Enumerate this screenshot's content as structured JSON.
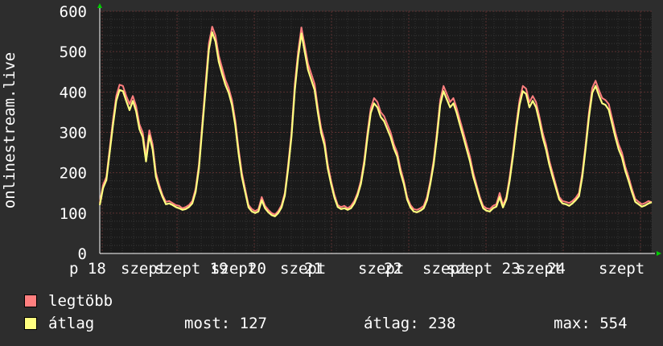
{
  "chart_data": {
    "type": "line",
    "ylabel": "onlinestream.live",
    "ylim": [
      0,
      600
    ],
    "y_ticks": [
      0,
      100,
      200,
      300,
      400,
      500,
      600
    ],
    "x_tick_labels": [
      "p 18",
      "szept",
      "szept 19",
      "szept",
      "20",
      "szept",
      "21",
      "szept",
      "22",
      "szept",
      "szept 23",
      "szept",
      "24",
      "szept"
    ],
    "grid": true,
    "series": [
      {
        "name": "legtöbb",
        "color": "#ff7f7f",
        "values": [
          125,
          170,
          190,
          260,
          330,
          390,
          418,
          415,
          390,
          370,
          390,
          365,
          320,
          300,
          240,
          305,
          270,
          200,
          170,
          145,
          128,
          130,
          125,
          120,
          118,
          112,
          115,
          120,
          130,
          160,
          220,
          320,
          420,
          520,
          562,
          540,
          490,
          460,
          430,
          410,
          380,
          330,
          260,
          200,
          160,
          120,
          110,
          105,
          110,
          140,
          118,
          108,
          100,
          96,
          105,
          120,
          150,
          220,
          300,
          420,
          500,
          560,
          515,
          470,
          445,
          420,
          360,
          310,
          280,
          220,
          180,
          145,
          120,
          115,
          118,
          112,
          118,
          130,
          150,
          180,
          230,
          300,
          360,
          385,
          375,
          350,
          340,
          320,
          300,
          270,
          250,
          210,
          180,
          140,
          120,
          110,
          108,
          112,
          118,
          140,
          180,
          230,
          300,
          380,
          415,
          395,
          375,
          385,
          360,
          330,
          300,
          270,
          240,
          200,
          170,
          140,
          118,
          112,
          110,
          118,
          122,
          150,
          120,
          140,
          190,
          250,
          320,
          380,
          415,
          408,
          375,
          390,
          375,
          340,
          300,
          270,
          230,
          200,
          170,
          140,
          130,
          128,
          125,
          130,
          138,
          150,
          200,
          270,
          350,
          410,
          428,
          405,
          385,
          380,
          370,
          335,
          300,
          270,
          250,
          215,
          190,
          160,
          135,
          128,
          122,
          125,
          130,
          127
        ]
      },
      {
        "name": "átlag",
        "color": "#ffff80",
        "values": [
          120,
          162,
          182,
          250,
          318,
          378,
          405,
          402,
          378,
          355,
          378,
          352,
          308,
          288,
          228,
          292,
          258,
          190,
          162,
          140,
          122,
          124,
          120,
          115,
          112,
          108,
          110,
          115,
          124,
          152,
          210,
          308,
          405,
          505,
          548,
          525,
          475,
          445,
          418,
          398,
          368,
          318,
          248,
          190,
          152,
          114,
          104,
          100,
          104,
          132,
          112,
          102,
          95,
          92,
          100,
          114,
          144,
          210,
          290,
          405,
          485,
          545,
          500,
          455,
          430,
          405,
          348,
          298,
          268,
          210,
          172,
          138,
          115,
          110,
          112,
          108,
          112,
          124,
          144,
          172,
          220,
          288,
          348,
          372,
          362,
          338,
          328,
          308,
          288,
          260,
          240,
          200,
          172,
          134,
          114,
          104,
          102,
          106,
          112,
          132,
          172,
          220,
          288,
          368,
          402,
          382,
          362,
          372,
          348,
          318,
          288,
          258,
          228,
          190,
          162,
          134,
          112,
          106,
          104,
          112,
          116,
          140,
          114,
          134,
          180,
          240,
          308,
          368,
          402,
          395,
          362,
          378,
          362,
          328,
          288,
          258,
          220,
          190,
          162,
          134,
          124,
          122,
          118,
          124,
          132,
          142,
          190,
          260,
          338,
          398,
          415,
          392,
          372,
          368,
          356,
          322,
          288,
          258,
          238,
          205,
          180,
          152,
          128,
          122,
          116,
          119,
          124,
          127
        ]
      }
    ]
  },
  "legend": {
    "items": [
      {
        "label": "legtöbb",
        "color": "#ff7f7f"
      },
      {
        "label": "átlag",
        "color": "#ffff80"
      }
    ]
  },
  "stats": {
    "now": "most: 127",
    "avg": "átlag: 238",
    "max": "max: 554"
  }
}
